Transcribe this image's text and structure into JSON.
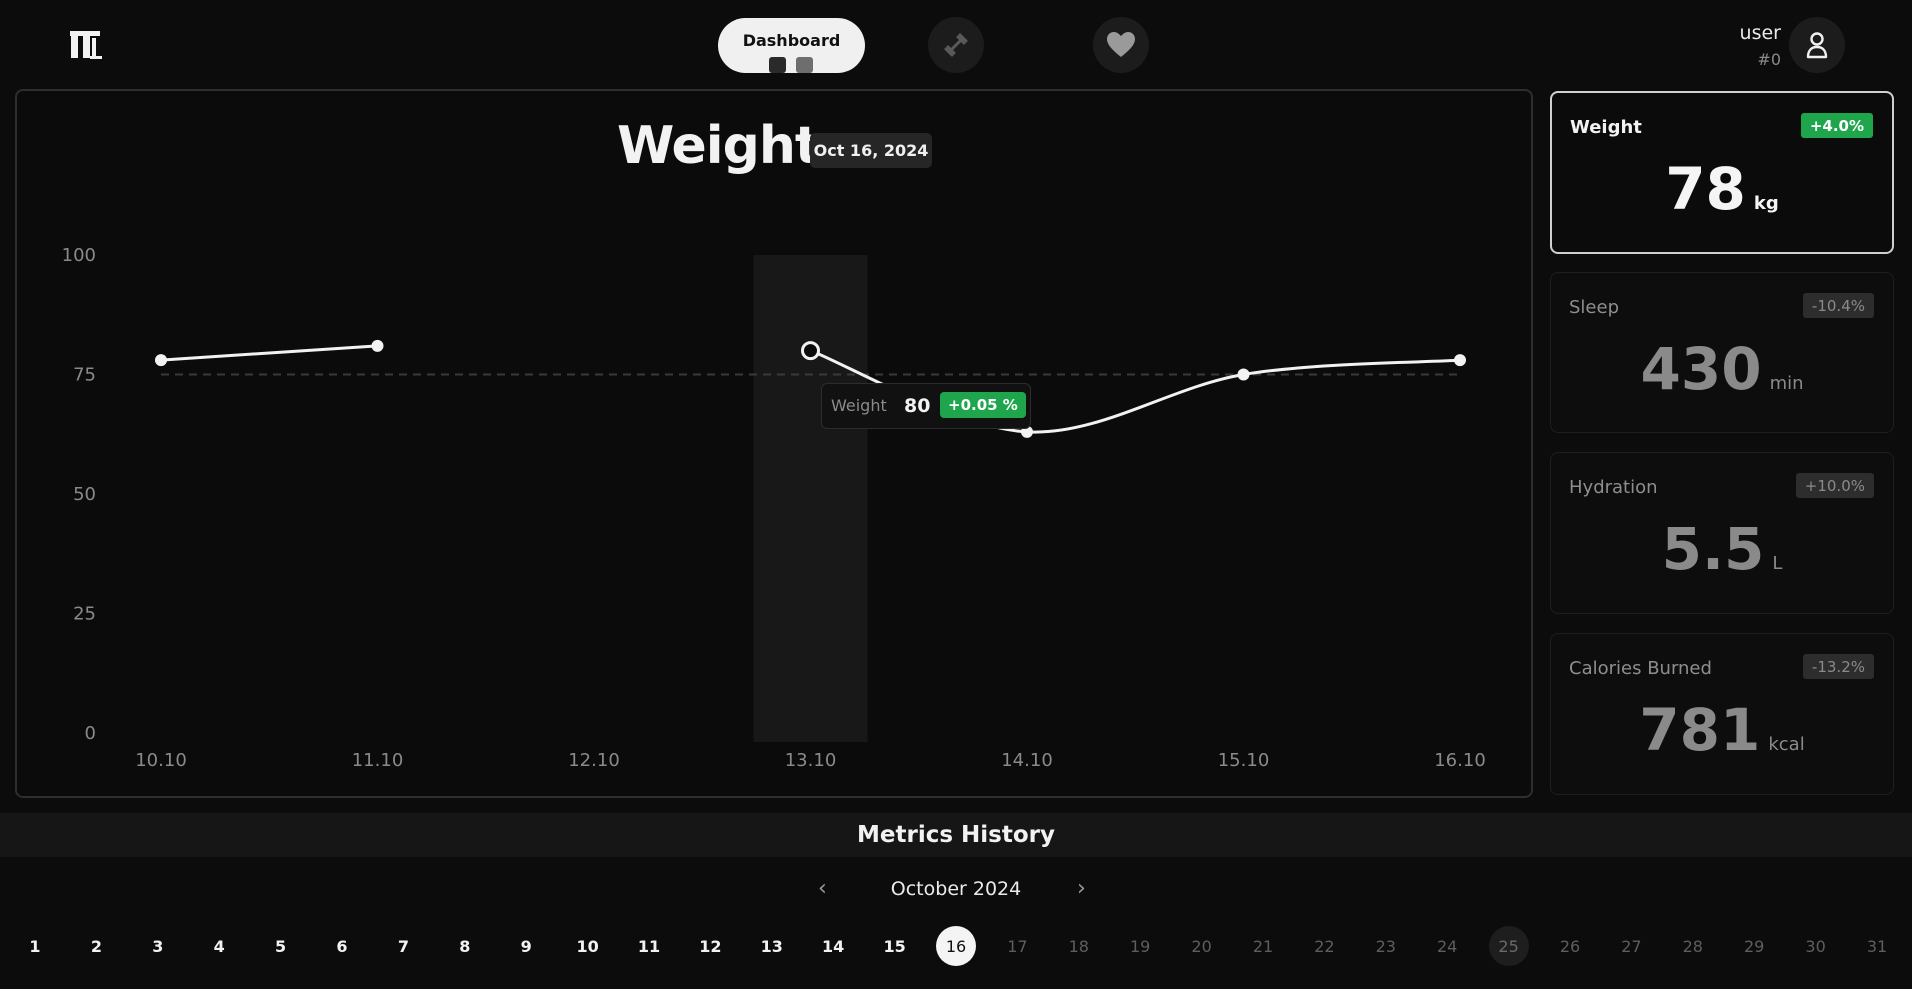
{
  "header": {
    "nav": {
      "dashboard_label": "Dashboard",
      "workout_icon": "dumbbell-icon",
      "health_icon": "heart-icon"
    },
    "user": {
      "name": "user",
      "id": "#0"
    }
  },
  "chart": {
    "title": "Weight",
    "date": "Oct 16, 2024",
    "tooltip": {
      "label": "Weight",
      "value": "80",
      "change": "+0.05 %"
    }
  },
  "chart_data": {
    "type": "line",
    "x": [
      "10.10",
      "11.10",
      "12.10",
      "13.10",
      "14.10",
      "15.10",
      "16.10"
    ],
    "series": [
      {
        "values": [
          78,
          81,
          null,
          80,
          63,
          75,
          78
        ]
      }
    ],
    "reference_line": 75,
    "ylim": [
      0,
      100
    ],
    "yticks": [
      100,
      75,
      50,
      25,
      0
    ],
    "highlight_x": "13.10",
    "grid": false
  },
  "cards": [
    {
      "label": "Weight",
      "change": "+4.0%",
      "value": "78",
      "unit": "kg"
    },
    {
      "label": "Sleep",
      "change": "-10.4%",
      "value": "430",
      "unit": "min"
    },
    {
      "label": "Hydration",
      "change": "+10.0%",
      "value": "5.5",
      "unit": "L"
    },
    {
      "label": "Calories Burned",
      "change": "-13.2%",
      "value": "781",
      "unit": "kcal"
    }
  ],
  "history": {
    "title": "Metrics History",
    "month": "October 2024",
    "prev": "‹",
    "next": "›",
    "current_day": 16,
    "marked_day": 25,
    "days": [
      1,
      2,
      3,
      4,
      5,
      6,
      7,
      8,
      9,
      10,
      11,
      12,
      13,
      14,
      15,
      16,
      17,
      18,
      19,
      20,
      21,
      22,
      23,
      24,
      25,
      26,
      27,
      28,
      29,
      30,
      31
    ]
  },
  "colors": {
    "accent_green": "#1fa64d",
    "background": "#0c0c0c"
  }
}
